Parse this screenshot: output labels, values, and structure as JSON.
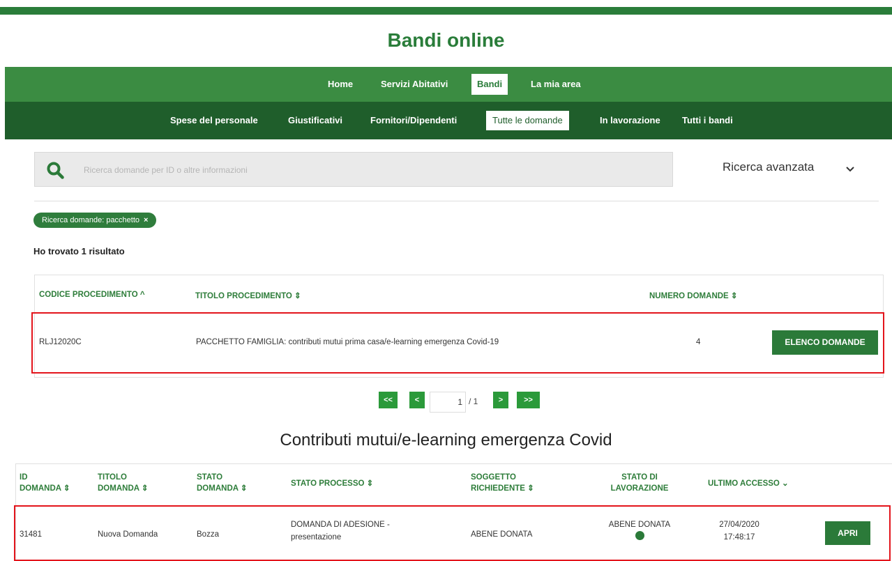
{
  "site": {
    "title": "Bandi online"
  },
  "nav_primary": [
    {
      "label": "Home",
      "active": false
    },
    {
      "label": "Servizi Abitativi",
      "active": false
    },
    {
      "label": "Bandi",
      "active": true
    },
    {
      "label": "La mia area",
      "active": false
    }
  ],
  "nav_secondary": [
    {
      "label": "Spese del personale",
      "active": false
    },
    {
      "label": "Giustificativi",
      "active": false
    },
    {
      "label": "Fornitori/Dipendenti",
      "active": false
    },
    {
      "label": "Tutte le domande",
      "active": true
    },
    {
      "label": "In lavorazione",
      "active": false
    },
    {
      "label": "Tutti i bandi",
      "active": false
    }
  ],
  "search": {
    "placeholder": "Ricerca domande per ID o altre informazioni",
    "advanced_label": "Ricerca avanzata",
    "search_icon": "search-icon",
    "advanced_icon": "chevron-down-icon"
  },
  "filter_chip": {
    "label": "Ricerca domande: pacchetto",
    "remove_symbol": "×"
  },
  "result_count": "Ho trovato 1 risultato",
  "procedures_table": {
    "columns": [
      "CODICE PROCEDIMENTO ^",
      "TITOLO PROCEDIMENTO ⇕",
      "NUMERO DOMANDE ⇕"
    ],
    "rows": [
      {
        "codice": "RLJ12020C",
        "titolo": "PACCHETTO FAMIGLIA: contributi mutui prima casa/e-learning emergenza Covid-19",
        "numero": "4",
        "action": "ELENCO DOMANDE"
      }
    ]
  },
  "pagination": {
    "first": "<<",
    "prev": "<",
    "current": "1",
    "total": "/ 1",
    "next": ">",
    "last": ">>"
  },
  "applications_section": {
    "title": "Contributi mutui/e-learning emergenza Covid",
    "columns": [
      {
        "line1": "ID",
        "line2": "DOMANDA ⇕"
      },
      {
        "line1": "TITOLO",
        "line2": "DOMANDA ⇕"
      },
      {
        "line1": "STATO",
        "line2": "DOMANDA ⇕"
      },
      {
        "line1": "STATO PROCESSO ⇕",
        "line2": ""
      },
      {
        "line1": "SOGGETTO",
        "line2": "RICHIEDENTE ⇕"
      },
      {
        "line1": "STATO DI",
        "line2": "LAVORAZIONE"
      },
      {
        "line1": "ULTIMO ACCESSO ⌄",
        "line2": ""
      }
    ],
    "rows": [
      {
        "id": "31481",
        "titolo": "Nuova Domanda",
        "stato": "Bozza",
        "processo_line1": "DOMANDA DI ADESIONE -",
        "processo_line2": "presentazione",
        "soggetto": "ABENE DONATA",
        "lavorazione": "ABENE DONATA",
        "status_dot_color": "#2b7a39",
        "accesso_date": "27/04/2020",
        "accesso_time": "17:48:17",
        "action": "APRI"
      }
    ]
  },
  "colors": {
    "primary_green": "#3b8c42",
    "dark_green": "#1f5e2b",
    "button_green": "#2b7a39",
    "highlight_red": "#e3141b"
  }
}
